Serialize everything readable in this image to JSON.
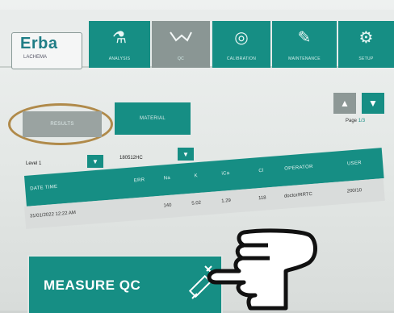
{
  "brand": {
    "logo_text": "Erba",
    "logo_sub": "LACHEMA"
  },
  "nav": [
    {
      "label": "ANALYSIS",
      "icon": "flask-icon",
      "glyph": "⚗"
    },
    {
      "label": "QC",
      "icon": "qc-chart-icon",
      "glyph": "⟋",
      "active": true
    },
    {
      "label": "CALIBRATION",
      "icon": "target-icon",
      "glyph": "◎"
    },
    {
      "label": "MAINTENANCE",
      "icon": "wrench-icon",
      "glyph": "✎"
    },
    {
      "label": "SETUP",
      "icon": "gear-icon",
      "glyph": "⚙"
    }
  ],
  "tabs": {
    "results": "RESULTS",
    "material": "MATERIAL"
  },
  "filters": {
    "level": "Level 1",
    "lot": "180512HC"
  },
  "paging": {
    "label": "Page",
    "current": "1/3"
  },
  "table": {
    "headers": [
      "DATE TIME",
      "ERR",
      "Na",
      "K",
      "iCa",
      "Cl",
      "OPERATOR",
      "USER"
    ],
    "rows": [
      [
        "31/01/2022 12:22 AM",
        "",
        "140",
        "5.02",
        "1.29",
        "118",
        "doctor/RRTC",
        "200/10"
      ]
    ]
  },
  "measure": {
    "label": "MEASURE QC"
  },
  "colors": {
    "accent": "#168e84",
    "inactive": "#8a9694",
    "highlight_oval": "#b08a4a"
  }
}
